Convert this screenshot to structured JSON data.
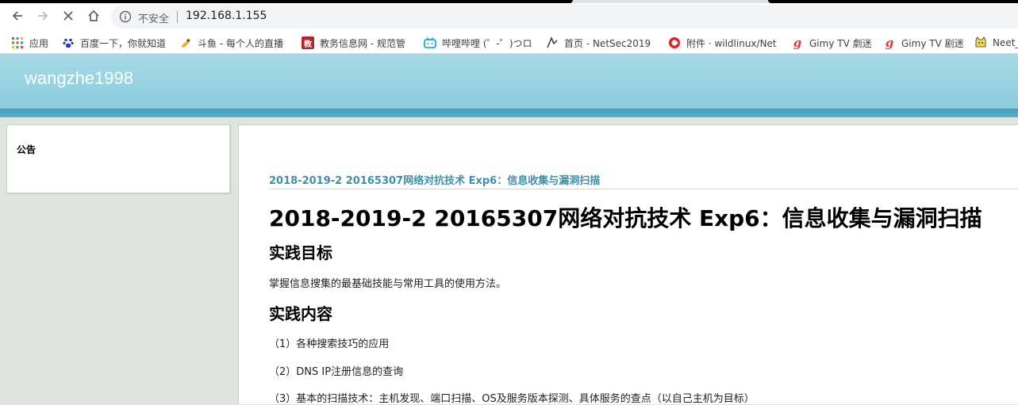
{
  "browser": {
    "insecure_label": "不安全",
    "url": "192.168.1.155"
  },
  "bookmarks": [
    {
      "label": "应用",
      "icon": "apps-grid-icon"
    },
    {
      "label": "百度一下，你就知道",
      "icon": "baidu-paw-icon"
    },
    {
      "label": "斗鱼 - 每个人的直播",
      "icon": "douyu-icon"
    },
    {
      "label": "教务信息网 - 规范管",
      "icon": "jiao-icon",
      "glyph": "教"
    },
    {
      "label": "哔哩哔哩 (゜-゜)つロ",
      "icon": "bilibili-tv-icon"
    },
    {
      "label": "首页 - NetSec2019",
      "icon": "netsec-icon"
    },
    {
      "label": "附件 · wildlinux/Net",
      "icon": "red-g-icon"
    },
    {
      "label": "Gimy TV 劇迷",
      "icon": "gimy-icon"
    },
    {
      "label": "Gimy TV 剧迷",
      "icon": "gimy-icon"
    },
    {
      "label": "Neet_",
      "icon": "neet-cat-icon"
    }
  ],
  "blog": {
    "title": "wangzhe1998"
  },
  "sidebar": {
    "notice_title": "公告"
  },
  "post": {
    "link_title": "2018-2019-2 20165307网络对抗技术 Exp6：信息收集与漏洞扫描",
    "title": "2018-2019-2 20165307网络对抗技术 Exp6：信息收集与漏洞扫描",
    "section1": "实践目标",
    "goal": "掌握信息搜集的最基础技能与常用工具的使用方法。",
    "section2": "实践内容",
    "items": [
      "（1）各种搜索技巧的应用",
      "（2）DNS IP注册信息的查询",
      "（3）基本的扫描技术：主机发现、端口扫描、OS及服务版本探测、具体服务的查点（以自己主机为目标）"
    ]
  },
  "colors": {
    "header_top": "#a6dbe6",
    "header_band": "#3f9cbf",
    "link": "#3d8fac",
    "page_bg": "#dfe5de"
  }
}
